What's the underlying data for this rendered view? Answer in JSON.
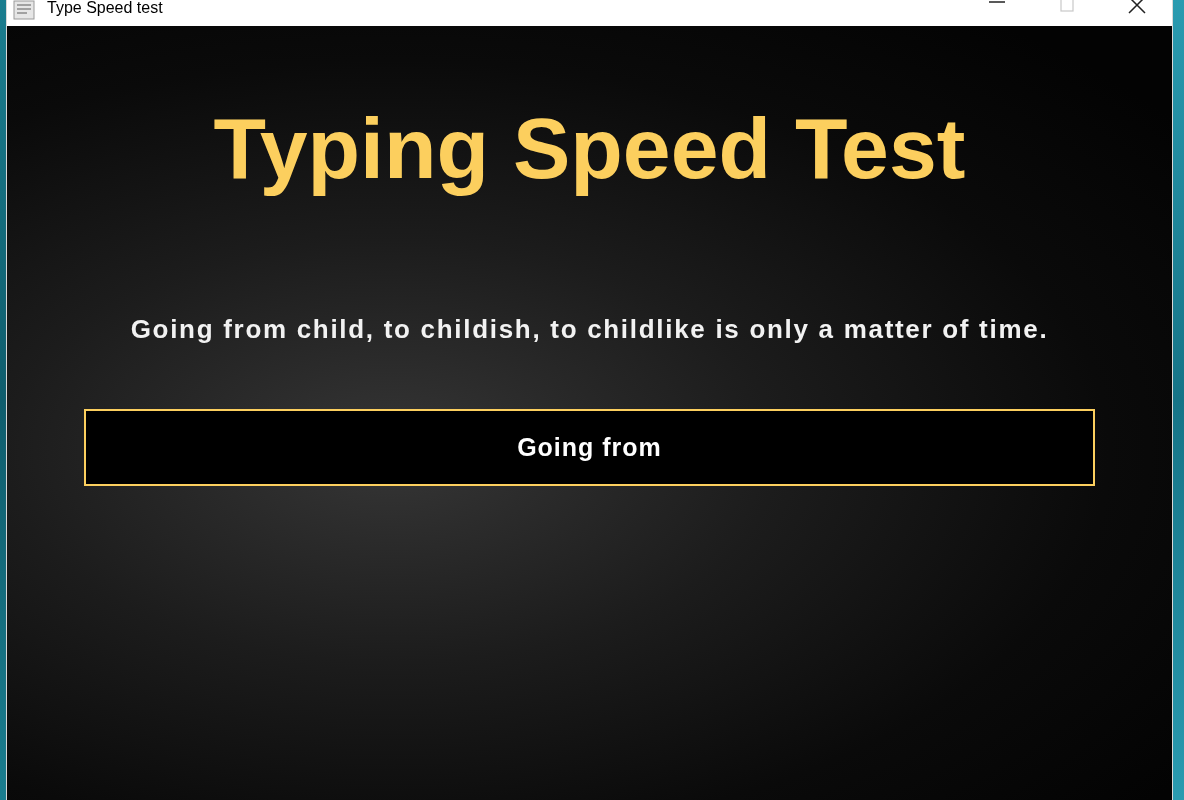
{
  "window": {
    "title": "Type Speed test",
    "controls": [
      {
        "kind": "minimize",
        "disabled": false
      },
      {
        "kind": "maximize",
        "disabled": true
      },
      {
        "kind": "close",
        "disabled": false
      }
    ]
  },
  "heading": "Typing Speed Test",
  "sentence": "Going from child, to childish, to childlike is only a matter of time.",
  "input": {
    "value": "Going from"
  }
}
